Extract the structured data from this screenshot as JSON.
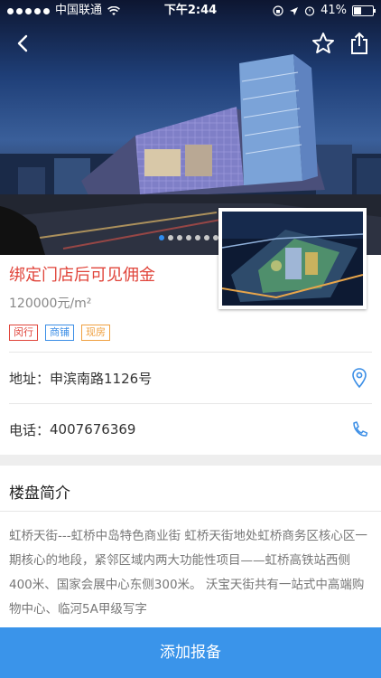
{
  "status_bar": {
    "carrier": "中国联通",
    "time": "下午2:44",
    "battery": "41%",
    "battery_level": 0.41
  },
  "hero": {
    "pagination": {
      "count": 9,
      "active_index": 0
    }
  },
  "promo_text": "绑定门店后可见佣金",
  "price": "120000元/m²",
  "tags": [
    {
      "label": "闵行",
      "color": "#e0443a"
    },
    {
      "label": "商铺",
      "color": "#3b8ee6"
    },
    {
      "label": "现房",
      "color": "#f0a040"
    }
  ],
  "address": {
    "label": "地址：",
    "value": "申滨南路1126号",
    "icon": "location-pin-icon"
  },
  "phone": {
    "label": "电话：",
    "value": "4007676369",
    "icon": "phone-icon"
  },
  "intro": {
    "title": "楼盘简介",
    "text": "虹桥天街---虹桥中岛特色商业街 虹桥天街地处虹桥商务区核心区一期核心的地段，紧邻区域内两大功能性项目——虹桥高铁站西侧400米、国家会展中心东侧300米。 沃宝天街共有一站式中高端购物中心、临河5A甲级写字"
  },
  "cta_label": "添加报备",
  "colors": {
    "accent": "#3a94ea",
    "promo": "#e0443a"
  }
}
